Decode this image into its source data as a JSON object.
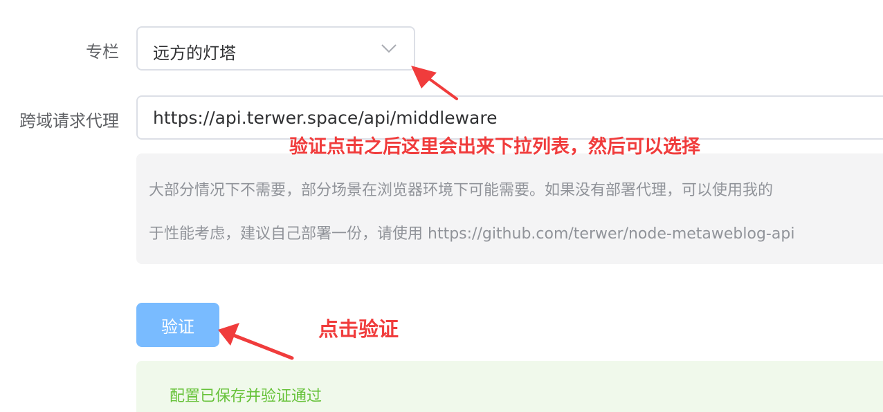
{
  "form": {
    "column_label": "专栏",
    "column_value": "远方的灯塔",
    "proxy_label": "跨域请求代理",
    "proxy_value": "https://api.terwer.space/api/middleware",
    "hint_line_1": "大部分情况下不需要，部分场景在浏览器环境下可能需要。如果没有部署代理，可以使用我的",
    "hint_line_2": "于性能考虑，建议自己部署一份，请使用 https://github.com/terwer/node-metaweblog-api",
    "verify_label": "验证",
    "success_message": "配置已保存并验证通过"
  },
  "annotations": {
    "dropdown_note": "验证点击之后这里会出来下拉列表，然后可以选择",
    "verify_note": "点击验证",
    "color": "#f03c3c"
  },
  "icons": {
    "select_arrow": "chevron-down-icon"
  },
  "colors": {
    "primary_light": "#79bbff",
    "success_text": "#67c23a",
    "success_bg": "#f0f9eb",
    "hint_bg": "#f4f4f5"
  }
}
